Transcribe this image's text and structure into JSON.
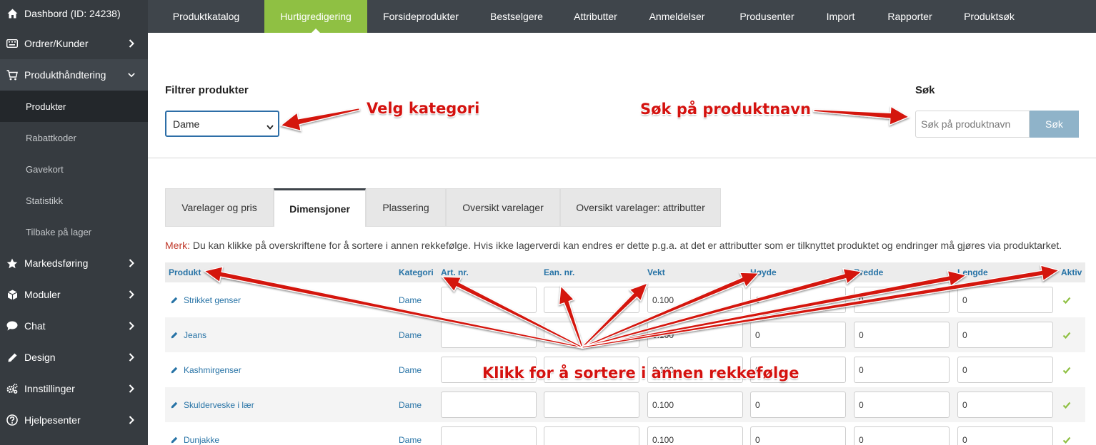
{
  "sidebar": {
    "dashboard": "Dashbord (ID: 24238)",
    "items": [
      {
        "label": "Ordrer/Kunder",
        "icon": "keyboard-icon"
      },
      {
        "label": "Produkthåndtering",
        "icon": "cart-icon"
      },
      {
        "label": "Markedsføring",
        "icon": "star-icon"
      },
      {
        "label": "Moduler",
        "icon": "cube-icon"
      },
      {
        "label": "Chat",
        "icon": "chat-icon"
      },
      {
        "label": "Design",
        "icon": "pencil-icon"
      },
      {
        "label": "Innstillinger",
        "icon": "gears-icon"
      },
      {
        "label": "Hjelpesenter",
        "icon": "help-icon"
      }
    ],
    "sub_items": [
      "Produkter",
      "Rabattkoder",
      "Gavekort",
      "Statistikk",
      "Tilbake på lager"
    ]
  },
  "topnav": {
    "tabs": [
      "Produktkatalog",
      "Hurtigredigering",
      "Forsideprodukter",
      "Bestselgere",
      "Attributter",
      "Anmeldelser",
      "Produsenter",
      "Import",
      "Rapporter",
      "Produktsøk"
    ],
    "active": "Hurtigredigering"
  },
  "filter": {
    "heading": "Filtrer produkter",
    "selected_category": "Dame"
  },
  "search": {
    "heading": "Søk",
    "placeholder": "Søk på produktnavn",
    "button": "Søk"
  },
  "tabs": {
    "items": [
      "Varelager og pris",
      "Dimensjoner",
      "Plassering",
      "Oversikt varelager",
      "Oversikt varelager: attributter"
    ],
    "active": "Dimensjoner"
  },
  "note": {
    "label": "Merk:",
    "text": " Du kan klikke på overskriftene for å sortere i annen rekkefølge. Hvis ikke lagerverdi kan endres er dette p.g.a. at det er attributter som er tilknyttet produktet og endringer må gjøres via produktarket."
  },
  "table": {
    "headers": [
      "Produkt",
      "Kategori",
      "Art. nr.",
      "Ean. nr.",
      "Vekt",
      "Høyde",
      "Bredde",
      "Lengde",
      "Aktiv"
    ],
    "rows": [
      {
        "name": "Strikket genser",
        "category": "Dame",
        "art": "",
        "ean": "",
        "weight": "0.100",
        "height": "0",
        "width": "0",
        "length": "0",
        "active": true
      },
      {
        "name": "Jeans",
        "category": "Dame",
        "art": "",
        "ean": "",
        "weight": "0.100",
        "height": "0",
        "width": "0",
        "length": "0",
        "active": true
      },
      {
        "name": "Kashmirgenser",
        "category": "Dame",
        "art": "",
        "ean": "",
        "weight": "0.100",
        "height": "0",
        "width": "0",
        "length": "0",
        "active": true
      },
      {
        "name": "Skulderveske i lær",
        "category": "Dame",
        "art": "",
        "ean": "",
        "weight": "0.100",
        "height": "0",
        "width": "0",
        "length": "0",
        "active": true
      },
      {
        "name": "Dunjakke",
        "category": "Dame",
        "art": "",
        "ean": "",
        "weight": "0.100",
        "height": "0",
        "width": "0",
        "length": "0",
        "active": true
      }
    ]
  },
  "annotations": {
    "category": "Velg kategori",
    "search": "Søk på produktnavn",
    "sort": "Klikk for å sortere i annen rekkefølge"
  },
  "colors": {
    "sidebar_bg": "#363b40",
    "topnav_bg": "#3f454b",
    "active_tab": "#8fc043",
    "link": "#2773a6",
    "annotation": "#d4120f",
    "search_button": "#8fb3c9"
  }
}
